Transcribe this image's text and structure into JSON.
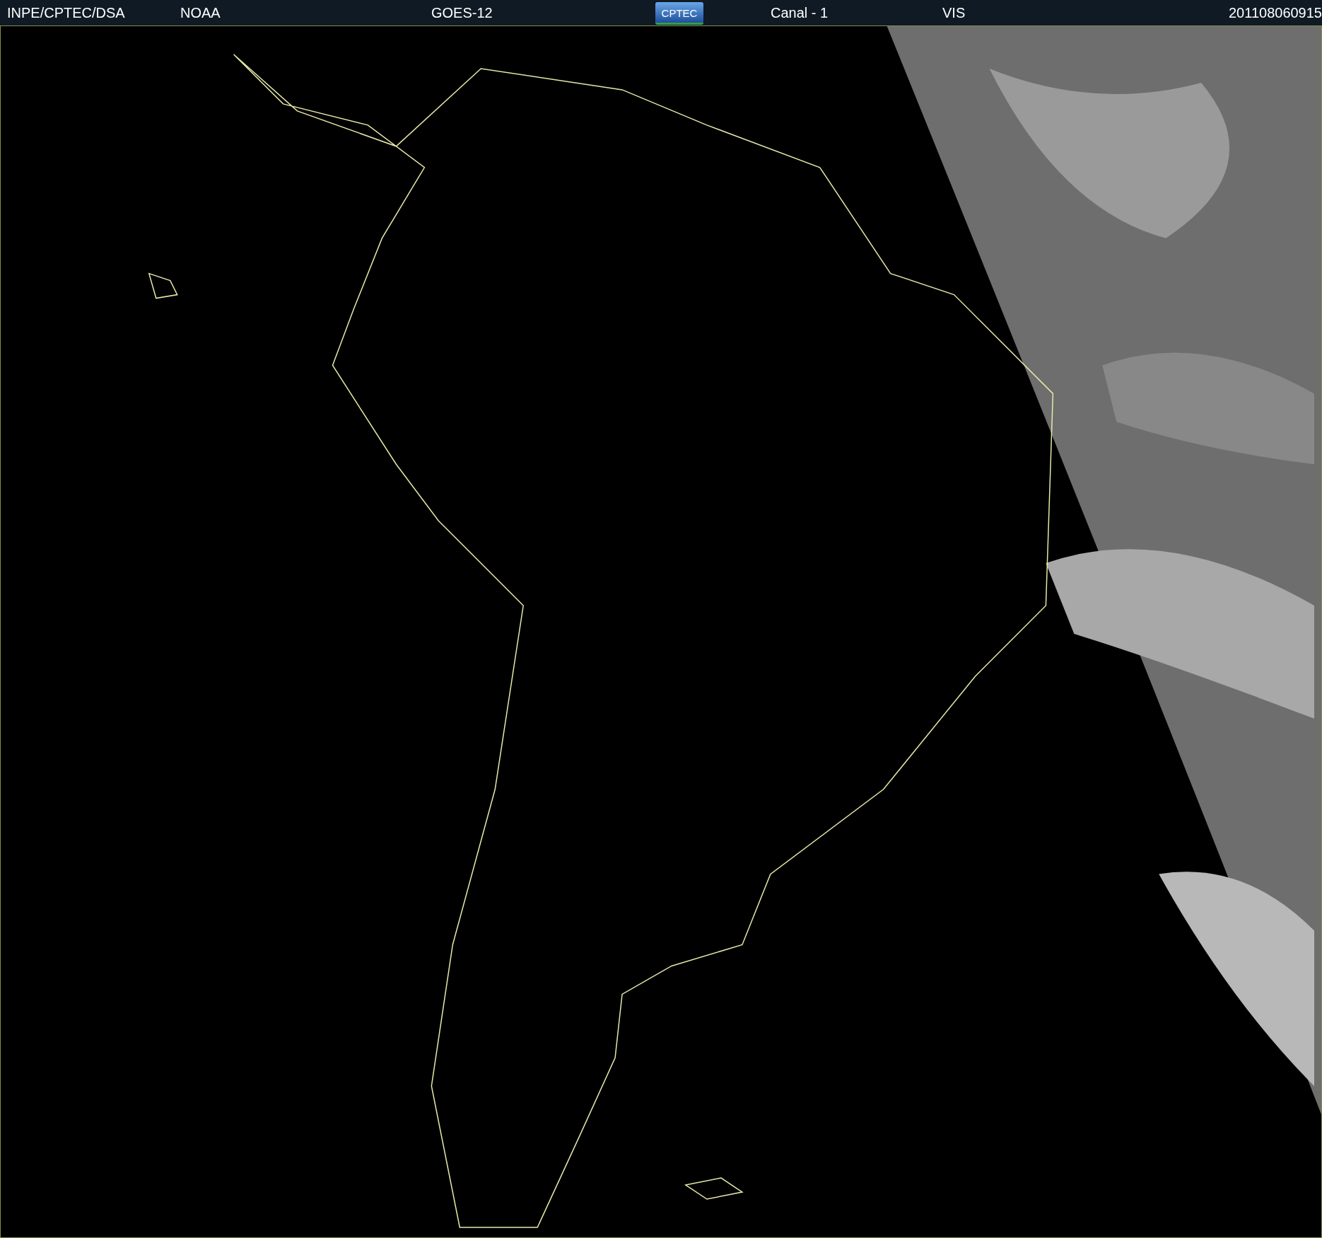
{
  "header": {
    "items": [
      {
        "kind": "text",
        "text": "INPE/CPTEC/DSA"
      },
      {
        "kind": "text",
        "text": "NOAA"
      },
      {
        "kind": "text",
        "text": "GOES-12"
      },
      {
        "kind": "logo",
        "text": "CPTEC"
      },
      {
        "kind": "text",
        "text": "Canal - 1"
      },
      {
        "kind": "text",
        "text": "VIS"
      },
      {
        "kind": "text",
        "text": "201108060915"
      }
    ]
  }
}
